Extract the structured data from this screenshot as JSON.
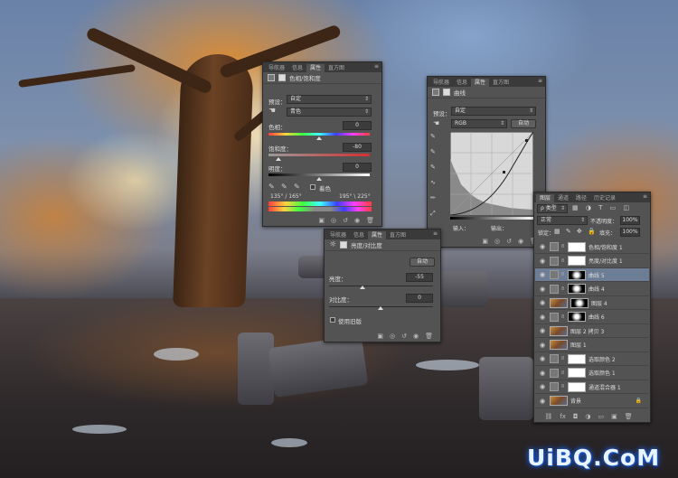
{
  "hue_panel": {
    "tabs": [
      "导航器",
      "信息",
      "属性",
      "直方图"
    ],
    "title": "色相/饱和度",
    "preset_label": "预设：",
    "preset_value": "自定",
    "channel_value": "青色",
    "hue_label": "色相：",
    "hue_value": "0",
    "saturation_label": "饱和度：",
    "saturation_value": "-80",
    "lightness_label": "明度：",
    "lightness_value": "0",
    "colorize_label": "着色",
    "range_left": "135° / 165°",
    "range_right": "195° \\ 225°"
  },
  "curves_panel": {
    "tabs": [
      "导航器",
      "信息",
      "属性",
      "直方图"
    ],
    "title": "曲线",
    "preset_label": "预设：",
    "preset_value": "自定",
    "channel_value": "RGB",
    "auto_label": "自动",
    "input_label": "输入：",
    "output_label": "输出："
  },
  "brightness_panel": {
    "tabs": [
      "导航器",
      "信息",
      "属性",
      "直方图"
    ],
    "title": "亮度/对比度",
    "auto_label": "自动",
    "brightness_label": "亮度：",
    "brightness_value": "-55",
    "contrast_label": "对比度：",
    "contrast_value": "0",
    "legacy_label": "使用旧版"
  },
  "layers_panel": {
    "tabs": [
      "图层",
      "通道",
      "路径",
      "历史记录"
    ],
    "filter_value": "ρ 类型",
    "blend_mode": "正常",
    "opacity_label": "不透明度：",
    "opacity_value": "100%",
    "lock_label": "锁定：",
    "fill_label": "填充：",
    "fill_value": "100%",
    "layers": [
      {
        "name": "色相/饱和度 1",
        "kind": "adj",
        "mask": "white",
        "selected": false
      },
      {
        "name": "亮度/对比度 1",
        "kind": "adj",
        "mask": "white",
        "selected": false
      },
      {
        "name": "曲线 5",
        "kind": "adj",
        "mask": "dark",
        "selected": true
      },
      {
        "name": "曲线 4",
        "kind": "adj",
        "mask": "dark",
        "selected": false
      },
      {
        "name": "图层 4",
        "kind": "img",
        "mask": "dark",
        "selected": false
      },
      {
        "name": "曲线 6",
        "kind": "adj",
        "mask": "dark",
        "selected": false
      },
      {
        "name": "图层 2 拷贝 3",
        "kind": "img",
        "mask": "none",
        "selected": false
      },
      {
        "name": "图层 1",
        "kind": "img",
        "mask": "none",
        "selected": false
      },
      {
        "name": "选取颜色 2",
        "kind": "adj",
        "mask": "white",
        "selected": false
      },
      {
        "name": "选取颜色 1",
        "kind": "adj",
        "mask": "white",
        "selected": false
      },
      {
        "name": "通道混合器 1",
        "kind": "adj",
        "mask": "white",
        "selected": false
      },
      {
        "name": "背景",
        "kind": "img",
        "mask": "none",
        "selected": false
      }
    ]
  },
  "watermark": "UiBQ.CoM",
  "colors": {
    "panel_bg": "#535353",
    "selection": "#6d7d95",
    "watermark_glow": "#1c5bd6"
  }
}
